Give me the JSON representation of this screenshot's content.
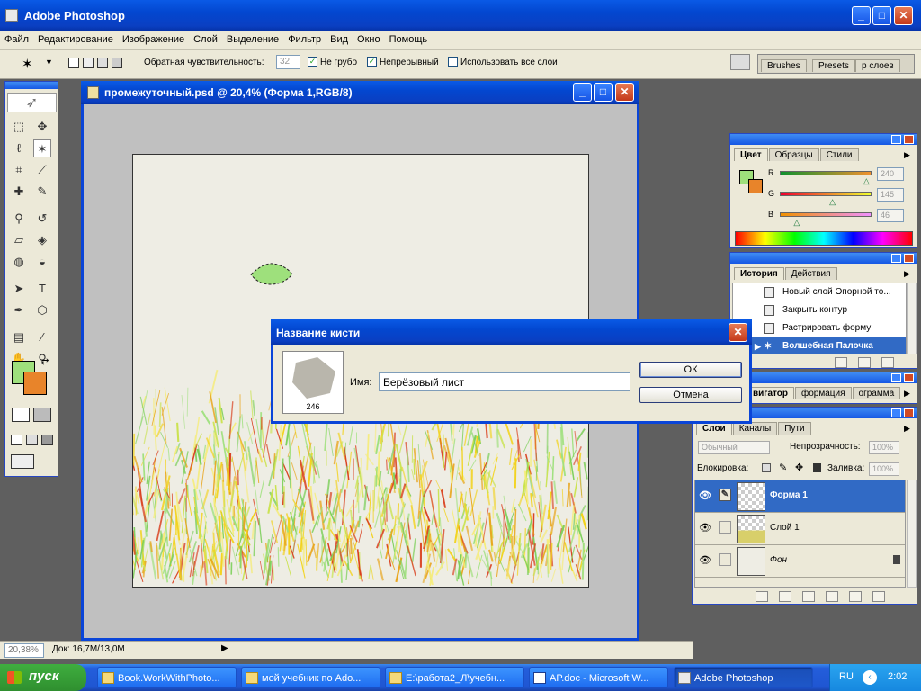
{
  "app": {
    "title": "Adobe Photoshop"
  },
  "menu": [
    "Файл",
    "Редактирование",
    "Изображение",
    "Слой",
    "Выделение",
    "Фильтр",
    "Вид",
    "Окно",
    "Помощь"
  ],
  "options": {
    "tolerance_label": "Обратная чувствительность:",
    "tolerance_value": "32",
    "antialias_label": "Не грубо",
    "antialias_checked": true,
    "contiguous_label": "Непрерывный",
    "contiguous_checked": true,
    "all_layers_label": "Использовать все слои",
    "all_layers_checked": false,
    "well_tabs": [
      "Brushes",
      "Presets",
      "р слоев"
    ]
  },
  "toolbox": {
    "icons": [
      "marquee-icon",
      "move-icon",
      "lasso-icon",
      "magic-wand-icon",
      "crop-icon",
      "slice-icon",
      "healing-brush-icon",
      "brush-icon",
      "clone-stamp-icon",
      "history-brush-icon",
      "eraser-icon",
      "paint-bucket-icon",
      "blur-icon",
      "dodge-icon",
      "path-select-icon",
      "type-icon",
      "pen-icon",
      "shape-icon",
      "notes-icon",
      "eyedropper-icon",
      "hand-icon",
      "zoom-icon"
    ],
    "fg_color": "#9ee07c",
    "bg_color": "#e8842a"
  },
  "document": {
    "title": "промежуточный.psd @ 20,4% (Форма 1,RGB/8)"
  },
  "dialog": {
    "title": "Название кисти",
    "brush_size": "246",
    "name_label": "Имя:",
    "name_value": "Берёзовый лист",
    "ok_label": "ОК",
    "cancel_label": "Отмена"
  },
  "color_panel": {
    "tabs": [
      "Цвет",
      "Образцы",
      "Стили"
    ],
    "r_label": "R",
    "r_value": "240",
    "g_label": "G",
    "g_value": "145",
    "b_label": "B",
    "b_value": "46",
    "r_level": 0.94,
    "g_level": 0.57,
    "b_level": 0.18
  },
  "history_panel": {
    "tabs": [
      "История",
      "Действия"
    ],
    "items": [
      "Новый слой Опорной то...",
      "Закрыть контур",
      "Растрировать форму",
      "Волшебная Палочка"
    ]
  },
  "navigator_panel": {
    "tabs": [
      "вигатор",
      "формация",
      "ограмма"
    ]
  },
  "layers_panel": {
    "tabs": [
      "Слои",
      "Каналы",
      "Пути"
    ],
    "blend_mode": "Обычный",
    "opacity_label": "Непрозрачность:",
    "opacity_value": "100%",
    "lock_label": "Блокировка:",
    "fill_label": "Заливка:",
    "fill_value": "100%",
    "layers": [
      "Форма 1",
      "Слой 1",
      "Фон"
    ]
  },
  "status": {
    "zoom": "20,38%",
    "doc_info": "Док: 16,7M/13,0M"
  },
  "taskbar": {
    "start_label": "пуск",
    "items": [
      "Book.WorkWithPhoto...",
      "мой учебник по Ado...",
      "E:\\работа2_Л\\учебн...",
      "AP.doc - Microsoft W...",
      "Adobe Photoshop"
    ],
    "lang": "RU",
    "time": "2:02"
  },
  "colors": {
    "xp_blue": "#0a5ae6",
    "selected_layer": "#316ac5",
    "panel_bg": "#ece9d8"
  }
}
